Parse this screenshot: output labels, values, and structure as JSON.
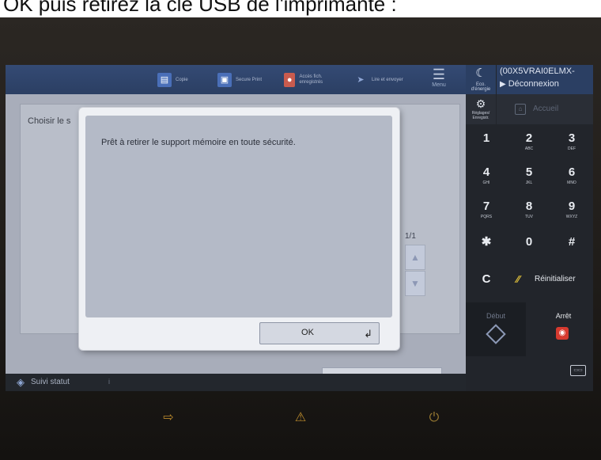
{
  "caption": {
    "text": "OK puis retirez la clé USB de l'imprimante :"
  },
  "toolbar": {
    "items": [
      {
        "label": "Copie",
        "icon": "copy-icon",
        "color": "#4a6fb8"
      },
      {
        "label": "Secure Print",
        "icon": "secure-print-icon",
        "color": "#4a6fb8"
      },
      {
        "label": "Accès fich. enregistrés",
        "icon": "stored-files-icon",
        "color": "#c95b4e"
      },
      {
        "label": "Lire et envoyer",
        "icon": "scan-send-icon",
        "color": "#5f79a8"
      }
    ],
    "menu_label": "Menu"
  },
  "main": {
    "choose_label": "Choisir le s",
    "page_count": "1/1"
  },
  "dialog": {
    "message": "Prêt à retirer le support mémoire en toute sécurité.",
    "ok_label": "OK"
  },
  "status": {
    "label": "Suivi statut",
    "dot": "i"
  },
  "right_panel": {
    "eco_label": "Eco. d'énergie",
    "user_name": "(00X5VRAI0ELMX-",
    "logout_label": "Déconnexion",
    "settings_label": "Réglages/ Enregistr.",
    "home_label": "Accueil",
    "keys": [
      {
        "digit": "1",
        "letters": ""
      },
      {
        "digit": "2",
        "letters": "ABC"
      },
      {
        "digit": "3",
        "letters": "DEF"
      },
      {
        "digit": "4",
        "letters": "GHI"
      },
      {
        "digit": "5",
        "letters": "JKL"
      },
      {
        "digit": "6",
        "letters": "MNO"
      },
      {
        "digit": "7",
        "letters": "PQRS"
      },
      {
        "digit": "8",
        "letters": "TUV"
      },
      {
        "digit": "9",
        "letters": "WXYZ"
      },
      {
        "digit": "✱",
        "letters": ""
      },
      {
        "digit": "0",
        "letters": ""
      },
      {
        "digit": "#",
        "letters": ""
      }
    ],
    "clear_label": "C",
    "reset_label": "Réinitialiser",
    "start_label": "Début",
    "stop_label": "Arrêt"
  },
  "colors": {
    "toolbar_bg": "#2b3f63",
    "dialog_bg": "#eef0f4",
    "stop_red": "#d63a2f",
    "reset_yellow": "#e2c23b"
  }
}
